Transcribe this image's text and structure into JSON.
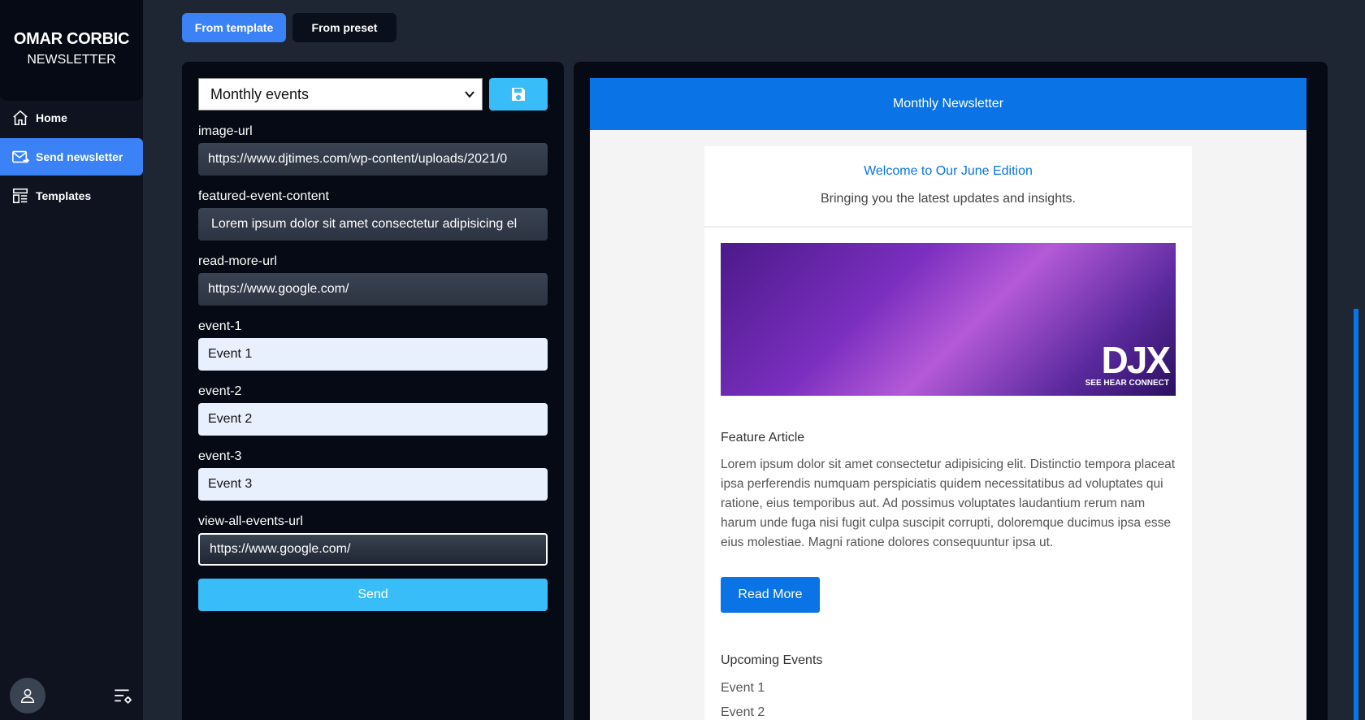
{
  "brand": {
    "title": "OMAR CORBIC",
    "subtitle": "NEWSLETTER"
  },
  "sidebar": {
    "items": [
      {
        "label": "Home",
        "icon": "home-icon"
      },
      {
        "label": "Send newsletter",
        "icon": "mail-send-icon",
        "active": true
      },
      {
        "label": "Templates",
        "icon": "templates-icon"
      }
    ]
  },
  "tabs": {
    "from_template": "From template",
    "from_preset": "From preset"
  },
  "form": {
    "template_select": "Monthly events",
    "fields": [
      {
        "label": "image-url",
        "value": "https://www.djtimes.com/wp-content/uploads/2021/0"
      },
      {
        "label": "featured-event-content",
        "value": "Lorem ipsum dolor sit amet consectetur adipisicing el"
      },
      {
        "label": "read-more-url",
        "value": "https://www.google.com/"
      },
      {
        "label": "event-1",
        "value": "Event 1"
      },
      {
        "label": "event-2",
        "value": "Event 2"
      },
      {
        "label": "event-3",
        "value": "Event 3"
      },
      {
        "label": "view-all-events-url",
        "value": "https://www.google.com/"
      }
    ],
    "send_label": "Send"
  },
  "preview": {
    "header": "Monthly Newsletter",
    "welcome": "Welcome to Our June Edition",
    "tagline": "Bringing you the latest updates and insights.",
    "image_logo": "DJX",
    "image_logo_sub": "SEE HEAR CONNECT",
    "feature_title": "Feature Article",
    "feature_body": "Lorem ipsum dolor sit amet consectetur adipisicing elit. Distinctio tempora placeat ipsa perferendis numquam perspiciatis quidem necessitatibus ad voluptates qui ratione, eius temporibus aut. Ad possimus voluptates laudantium rerum nam harum unde fuga nisi fugit culpa suscipit corrupti, doloremque ducimus ipsa esse eius molestiae. Magni ratione dolores consequuntur ipsa ut.",
    "read_more": "Read More",
    "upcoming_title": "Upcoming Events",
    "events": [
      "Event 1",
      "Event 2"
    ]
  },
  "colors": {
    "accent": "#3b82f6",
    "cyan": "#38bdf8",
    "newsletter_blue": "#0a74e6"
  }
}
